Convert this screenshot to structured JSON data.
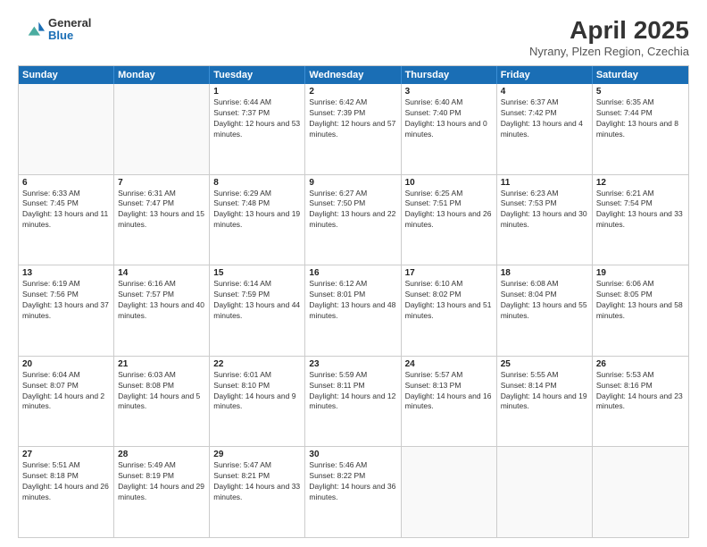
{
  "logo": {
    "general": "General",
    "blue": "Blue"
  },
  "title": "April 2025",
  "location": "Nyrany, Plzen Region, Czechia",
  "header_days": [
    "Sunday",
    "Monday",
    "Tuesday",
    "Wednesday",
    "Thursday",
    "Friday",
    "Saturday"
  ],
  "weeks": [
    [
      {
        "day": "",
        "empty": true
      },
      {
        "day": "",
        "empty": true
      },
      {
        "day": "1",
        "sunrise": "Sunrise: 6:44 AM",
        "sunset": "Sunset: 7:37 PM",
        "daylight": "Daylight: 12 hours and 53 minutes."
      },
      {
        "day": "2",
        "sunrise": "Sunrise: 6:42 AM",
        "sunset": "Sunset: 7:39 PM",
        "daylight": "Daylight: 12 hours and 57 minutes."
      },
      {
        "day": "3",
        "sunrise": "Sunrise: 6:40 AM",
        "sunset": "Sunset: 7:40 PM",
        "daylight": "Daylight: 13 hours and 0 minutes."
      },
      {
        "day": "4",
        "sunrise": "Sunrise: 6:37 AM",
        "sunset": "Sunset: 7:42 PM",
        "daylight": "Daylight: 13 hours and 4 minutes."
      },
      {
        "day": "5",
        "sunrise": "Sunrise: 6:35 AM",
        "sunset": "Sunset: 7:44 PM",
        "daylight": "Daylight: 13 hours and 8 minutes."
      }
    ],
    [
      {
        "day": "6",
        "sunrise": "Sunrise: 6:33 AM",
        "sunset": "Sunset: 7:45 PM",
        "daylight": "Daylight: 13 hours and 11 minutes."
      },
      {
        "day": "7",
        "sunrise": "Sunrise: 6:31 AM",
        "sunset": "Sunset: 7:47 PM",
        "daylight": "Daylight: 13 hours and 15 minutes."
      },
      {
        "day": "8",
        "sunrise": "Sunrise: 6:29 AM",
        "sunset": "Sunset: 7:48 PM",
        "daylight": "Daylight: 13 hours and 19 minutes."
      },
      {
        "day": "9",
        "sunrise": "Sunrise: 6:27 AM",
        "sunset": "Sunset: 7:50 PM",
        "daylight": "Daylight: 13 hours and 22 minutes."
      },
      {
        "day": "10",
        "sunrise": "Sunrise: 6:25 AM",
        "sunset": "Sunset: 7:51 PM",
        "daylight": "Daylight: 13 hours and 26 minutes."
      },
      {
        "day": "11",
        "sunrise": "Sunrise: 6:23 AM",
        "sunset": "Sunset: 7:53 PM",
        "daylight": "Daylight: 13 hours and 30 minutes."
      },
      {
        "day": "12",
        "sunrise": "Sunrise: 6:21 AM",
        "sunset": "Sunset: 7:54 PM",
        "daylight": "Daylight: 13 hours and 33 minutes."
      }
    ],
    [
      {
        "day": "13",
        "sunrise": "Sunrise: 6:19 AM",
        "sunset": "Sunset: 7:56 PM",
        "daylight": "Daylight: 13 hours and 37 minutes."
      },
      {
        "day": "14",
        "sunrise": "Sunrise: 6:16 AM",
        "sunset": "Sunset: 7:57 PM",
        "daylight": "Daylight: 13 hours and 40 minutes."
      },
      {
        "day": "15",
        "sunrise": "Sunrise: 6:14 AM",
        "sunset": "Sunset: 7:59 PM",
        "daylight": "Daylight: 13 hours and 44 minutes."
      },
      {
        "day": "16",
        "sunrise": "Sunrise: 6:12 AM",
        "sunset": "Sunset: 8:01 PM",
        "daylight": "Daylight: 13 hours and 48 minutes."
      },
      {
        "day": "17",
        "sunrise": "Sunrise: 6:10 AM",
        "sunset": "Sunset: 8:02 PM",
        "daylight": "Daylight: 13 hours and 51 minutes."
      },
      {
        "day": "18",
        "sunrise": "Sunrise: 6:08 AM",
        "sunset": "Sunset: 8:04 PM",
        "daylight": "Daylight: 13 hours and 55 minutes."
      },
      {
        "day": "19",
        "sunrise": "Sunrise: 6:06 AM",
        "sunset": "Sunset: 8:05 PM",
        "daylight": "Daylight: 13 hours and 58 minutes."
      }
    ],
    [
      {
        "day": "20",
        "sunrise": "Sunrise: 6:04 AM",
        "sunset": "Sunset: 8:07 PM",
        "daylight": "Daylight: 14 hours and 2 minutes."
      },
      {
        "day": "21",
        "sunrise": "Sunrise: 6:03 AM",
        "sunset": "Sunset: 8:08 PM",
        "daylight": "Daylight: 14 hours and 5 minutes."
      },
      {
        "day": "22",
        "sunrise": "Sunrise: 6:01 AM",
        "sunset": "Sunset: 8:10 PM",
        "daylight": "Daylight: 14 hours and 9 minutes."
      },
      {
        "day": "23",
        "sunrise": "Sunrise: 5:59 AM",
        "sunset": "Sunset: 8:11 PM",
        "daylight": "Daylight: 14 hours and 12 minutes."
      },
      {
        "day": "24",
        "sunrise": "Sunrise: 5:57 AM",
        "sunset": "Sunset: 8:13 PM",
        "daylight": "Daylight: 14 hours and 16 minutes."
      },
      {
        "day": "25",
        "sunrise": "Sunrise: 5:55 AM",
        "sunset": "Sunset: 8:14 PM",
        "daylight": "Daylight: 14 hours and 19 minutes."
      },
      {
        "day": "26",
        "sunrise": "Sunrise: 5:53 AM",
        "sunset": "Sunset: 8:16 PM",
        "daylight": "Daylight: 14 hours and 23 minutes."
      }
    ],
    [
      {
        "day": "27",
        "sunrise": "Sunrise: 5:51 AM",
        "sunset": "Sunset: 8:18 PM",
        "daylight": "Daylight: 14 hours and 26 minutes."
      },
      {
        "day": "28",
        "sunrise": "Sunrise: 5:49 AM",
        "sunset": "Sunset: 8:19 PM",
        "daylight": "Daylight: 14 hours and 29 minutes."
      },
      {
        "day": "29",
        "sunrise": "Sunrise: 5:47 AM",
        "sunset": "Sunset: 8:21 PM",
        "daylight": "Daylight: 14 hours and 33 minutes."
      },
      {
        "day": "30",
        "sunrise": "Sunrise: 5:46 AM",
        "sunset": "Sunset: 8:22 PM",
        "daylight": "Daylight: 14 hours and 36 minutes."
      },
      {
        "day": "",
        "empty": true
      },
      {
        "day": "",
        "empty": true
      },
      {
        "day": "",
        "empty": true
      }
    ]
  ]
}
